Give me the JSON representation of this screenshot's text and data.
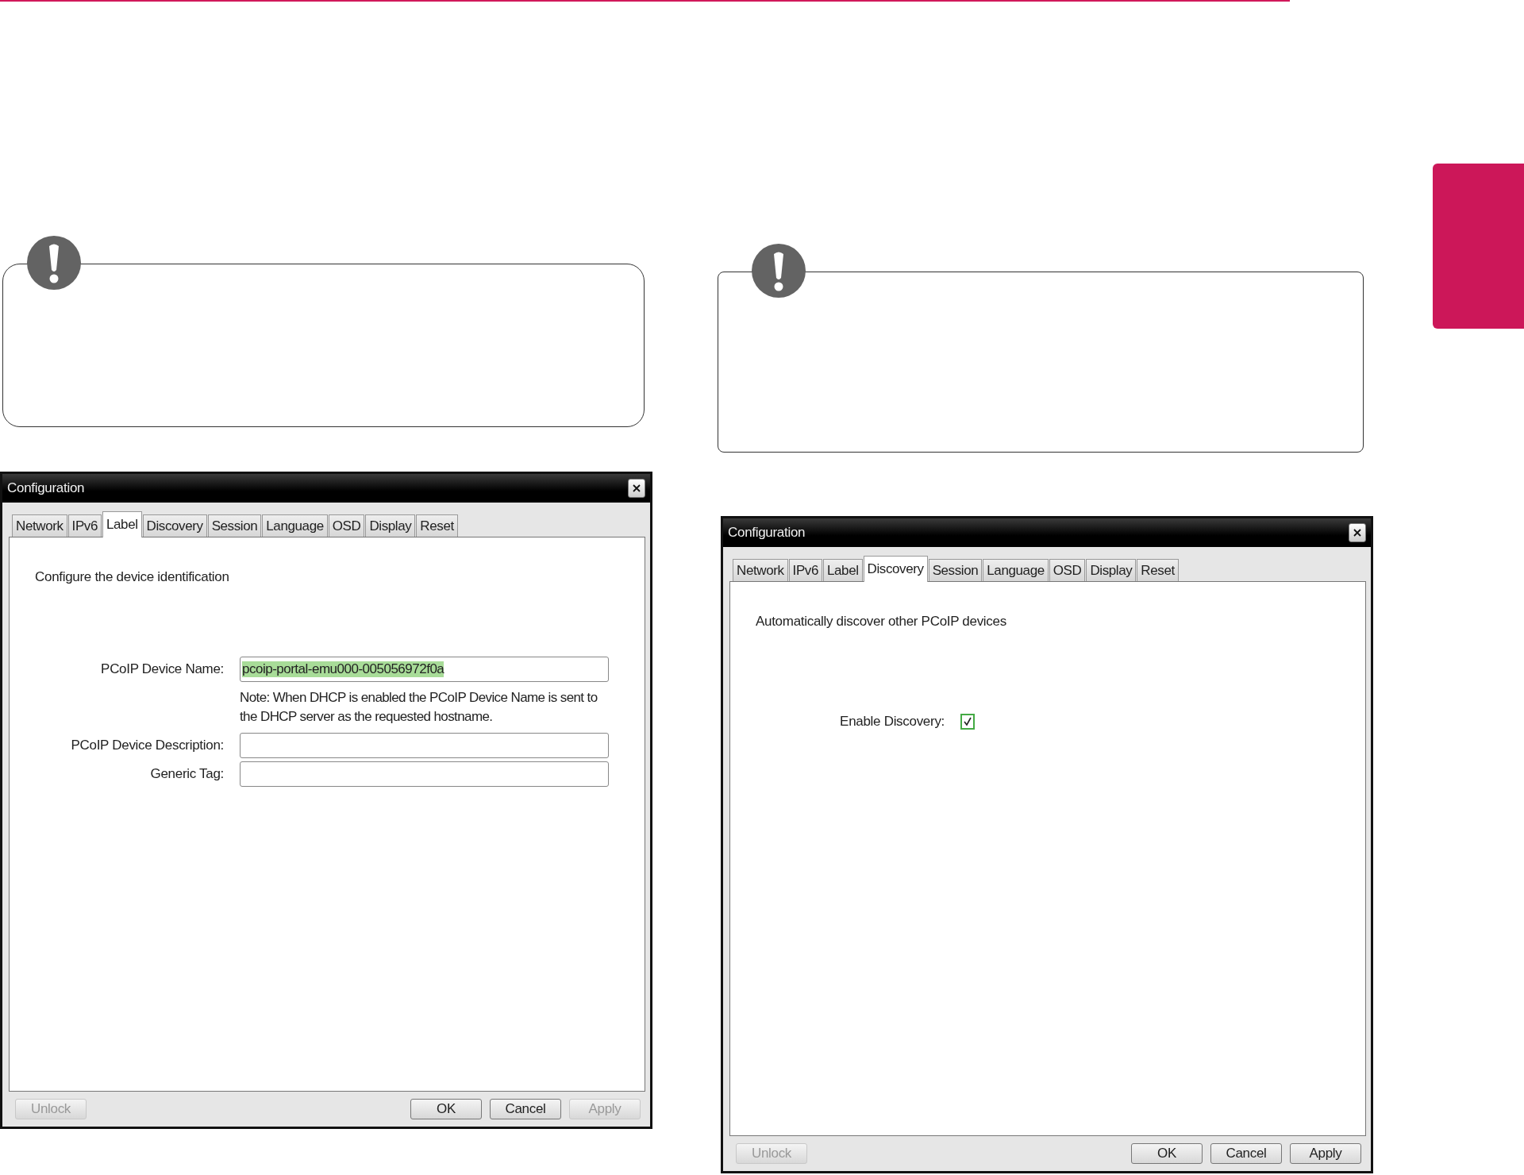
{
  "notes": [
    {
      "kind": "note"
    },
    {
      "kind": "note"
    }
  ],
  "dialogs": [
    {
      "title": "Configuration",
      "tabs": [
        {
          "label": "Network",
          "selected": false
        },
        {
          "label": "IPv6",
          "selected": false
        },
        {
          "label": "Label",
          "selected": true
        },
        {
          "label": "Discovery",
          "selected": false
        },
        {
          "label": "Session",
          "selected": false
        },
        {
          "label": "Language",
          "selected": false
        },
        {
          "label": "OSD",
          "selected": false
        },
        {
          "label": "Display",
          "selected": false
        },
        {
          "label": "Reset",
          "selected": false
        }
      ],
      "description": "Configure the device identification",
      "fields": [
        {
          "kind": "text",
          "label": "PCoIP Device Name:",
          "value": "pcoip-portal-emu000-005056972f0a",
          "value_selected": true
        },
        {
          "kind": "note",
          "text": "Note: When DHCP is enabled the PCoIP Device Name is sent to the DHCP server as the requested hostname."
        },
        {
          "kind": "text",
          "label": "PCoIP Device Description:"
        },
        {
          "kind": "text",
          "label": "Generic Tag:"
        }
      ],
      "buttons": [
        {
          "label": "Unlock",
          "disabled": true
        },
        {
          "label": "OK",
          "disabled": false
        },
        {
          "label": "Cancel",
          "disabled": false
        },
        {
          "label": "Apply",
          "disabled": true
        }
      ]
    },
    {
      "title": "Configuration",
      "tabs": [
        {
          "label": "Network",
          "selected": false
        },
        {
          "label": "IPv6",
          "selected": false
        },
        {
          "label": "Label",
          "selected": false
        },
        {
          "label": "Discovery",
          "selected": true
        },
        {
          "label": "Session",
          "selected": false
        },
        {
          "label": "Language",
          "selected": false
        },
        {
          "label": "OSD",
          "selected": false
        },
        {
          "label": "Display",
          "selected": false
        },
        {
          "label": "Reset",
          "selected": false
        }
      ],
      "description": "Automatically discover other PCoIP devices",
      "fields": [
        {
          "kind": "checkbox",
          "label": "Enable Discovery:",
          "checked": true
        }
      ],
      "buttons": [
        {
          "label": "Unlock",
          "disabled": true
        },
        {
          "label": "OK",
          "disabled": false
        },
        {
          "label": "Cancel",
          "disabled": false
        },
        {
          "label": "Apply",
          "disabled": false
        }
      ]
    }
  ]
}
